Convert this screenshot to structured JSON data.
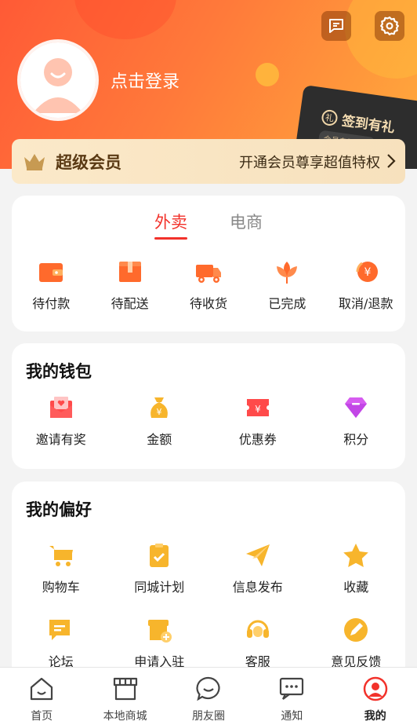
{
  "header": {
    "login_text": "点击登录",
    "signin_card": {
      "title": "签到有礼",
      "subtitle": "会员专属优惠"
    }
  },
  "member": {
    "title": "超级会员",
    "promo": "开通会员尊享超值特权"
  },
  "orders": {
    "tabs": [
      {
        "label": "外卖",
        "active": true
      },
      {
        "label": "电商",
        "active": false
      }
    ],
    "items": [
      {
        "label": "待付款",
        "icon": "wallet-icon"
      },
      {
        "label": "待配送",
        "icon": "package-icon"
      },
      {
        "label": "待收货",
        "icon": "truck-icon"
      },
      {
        "label": "已完成",
        "icon": "lotus-icon"
      },
      {
        "label": "取消/退款",
        "icon": "refund-icon"
      }
    ]
  },
  "wallet": {
    "title": "我的钱包",
    "items": [
      {
        "label": "邀请有奖",
        "icon": "envelope-heart-icon"
      },
      {
        "label": "金额",
        "icon": "money-bag-icon"
      },
      {
        "label": "优惠券",
        "icon": "coupon-icon"
      },
      {
        "label": "积分",
        "icon": "diamond-icon"
      }
    ]
  },
  "prefs": {
    "title": "我的偏好",
    "items": [
      {
        "label": "购物车",
        "icon": "cart-icon"
      },
      {
        "label": "同城计划",
        "icon": "clipboard-check-icon"
      },
      {
        "label": "信息发布",
        "icon": "paper-plane-icon"
      },
      {
        "label": "收藏",
        "icon": "star-icon"
      },
      {
        "label": "论坛",
        "icon": "chat-icon"
      },
      {
        "label": "申请入驻",
        "icon": "store-add-icon"
      },
      {
        "label": "客服",
        "icon": "headset-icon"
      },
      {
        "label": "意见反馈",
        "icon": "pencil-icon"
      }
    ]
  },
  "tabbar": [
    {
      "label": "首页",
      "icon": "home-icon"
    },
    {
      "label": "本地商城",
      "icon": "shop-icon"
    },
    {
      "label": "朋友圈",
      "icon": "smile-chat-icon"
    },
    {
      "label": "通知",
      "icon": "notify-icon"
    },
    {
      "label": "我的",
      "icon": "profile-icon",
      "active": true
    }
  ],
  "colors": {
    "accent": "#f2322b",
    "orange": "#ff6a2c",
    "gold": "#f7b52c"
  }
}
